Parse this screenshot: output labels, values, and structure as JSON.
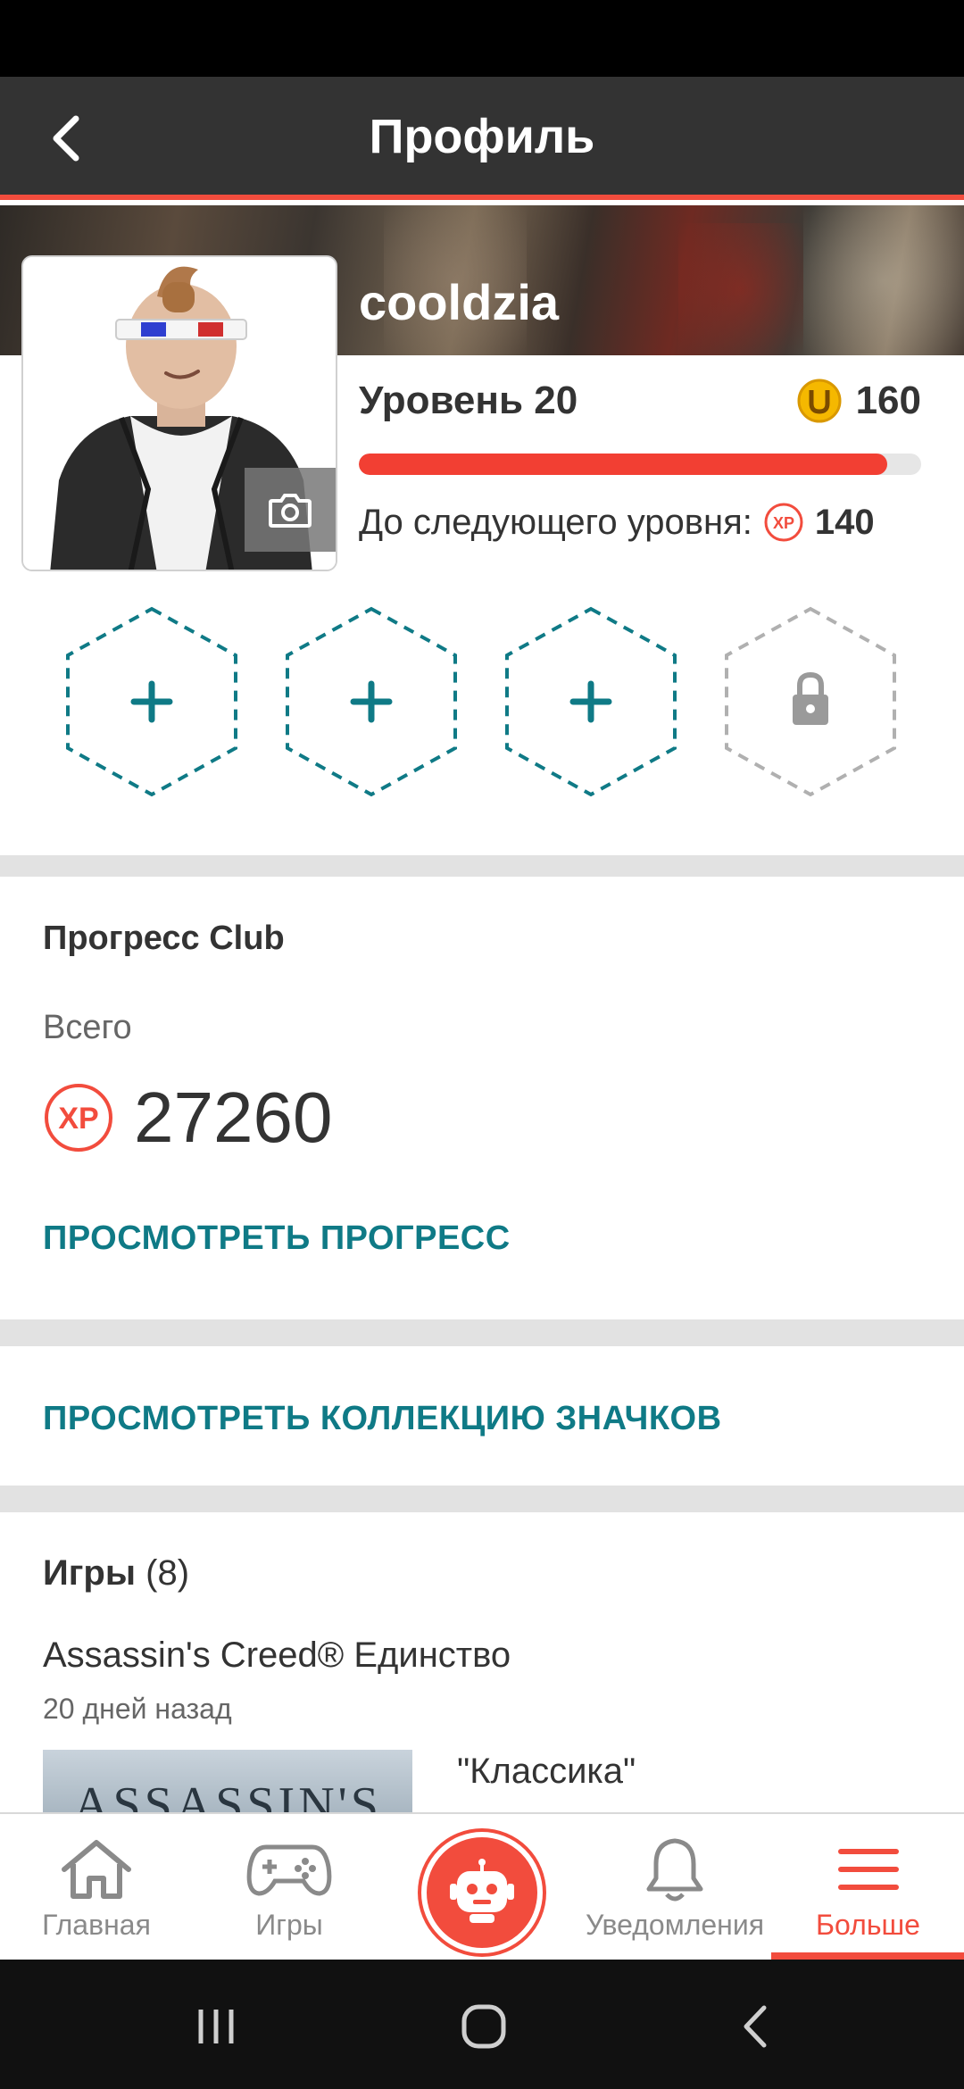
{
  "header": {
    "title": "Профиль"
  },
  "profile": {
    "username": "cooldzia",
    "level_label": "Уровень 20",
    "coins": "160",
    "level_progress_fraction": 0.94,
    "next_level_label": "До следующего уровня:",
    "next_level_xp": "140"
  },
  "badges": {
    "slots": [
      {
        "state": "empty-add",
        "icon": "plus-icon"
      },
      {
        "state": "empty-add",
        "icon": "plus-icon"
      },
      {
        "state": "empty-add",
        "icon": "plus-icon"
      },
      {
        "state": "locked",
        "icon": "lock-icon"
      }
    ]
  },
  "club": {
    "title": "Прогресс Club",
    "total_label": "Всего",
    "total_xp": "27260",
    "view_progress": "ПРОСМОТРЕТЬ ПРОГРЕСС"
  },
  "badge_collection": {
    "link": "ПРОСМОТРЕТЬ КОЛЛЕКЦИЮ ЗНАЧКОВ"
  },
  "games": {
    "title": "Игры",
    "count": "(8)",
    "items": [
      {
        "name": "Assassin's Creed® Единство",
        "date": "20 дней назад",
        "thumb_text": "ASSASSIN'S",
        "achievement": "\"Классика\""
      }
    ]
  },
  "xp_badge_text": "XP",
  "bottom_nav": {
    "items": [
      {
        "label": "Главная",
        "icon": "home-icon"
      },
      {
        "label": "Игры",
        "icon": "gamepad-icon"
      },
      {
        "label": "",
        "icon": "robot-icon"
      },
      {
        "label": "Уведомления",
        "icon": "bell-icon"
      },
      {
        "label": "Больше",
        "icon": "menu-icon",
        "active": true
      }
    ]
  },
  "colors": {
    "accent": "#f24c3d",
    "link": "#0f7a86",
    "appbar": "#333333",
    "coin": "#f5b800"
  }
}
